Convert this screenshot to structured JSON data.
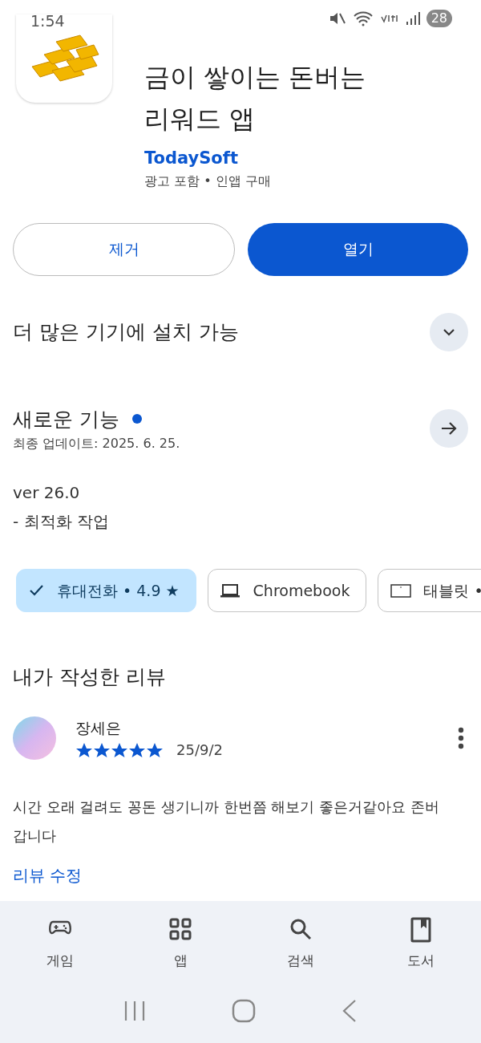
{
  "status_bar": {
    "time": "1:54",
    "battery": "28"
  },
  "app": {
    "title_lines": [
      "금이 쌓이는 돈버는",
      "리워드 앱"
    ],
    "developer": "TodaySoft",
    "info": "광고 포함 • 인앱 구매"
  },
  "buttons": [
    {
      "label": "제거",
      "kind": "outline"
    },
    {
      "label": "열기",
      "kind": "filled"
    }
  ],
  "install_section": {
    "title": "더 많은 기기에 설치 가능",
    "expanded": false
  },
  "whats_new": {
    "title": "새로운 기능",
    "new": true,
    "updated": "최종 업데이트: 2025. 6. 25.",
    "version": "ver 26.0",
    "notes": "- 최적화 작업"
  },
  "device_chips": [
    {
      "label": "휴대전화 • 4.9 ★",
      "kind": "phone",
      "selected": true
    },
    {
      "label": "Chromebook",
      "kind": "laptop",
      "selected": false
    },
    {
      "label": "태블릿 •",
      "kind": "tablet",
      "selected": false
    }
  ],
  "my_review": {
    "heading": "내가 작성한 리뷰",
    "author": "장세은",
    "stars": 5,
    "date": "25/9/2",
    "text": "시간 오래 걸려도 꽁돈 생기니까 한번쯤 해보기 좋은거같아요 존버갑니다",
    "edit_link": "리뷰 수정"
  },
  "bottom_nav": [
    {
      "label": "게임",
      "kind": "games"
    },
    {
      "label": "앱",
      "kind": "apps"
    },
    {
      "label": "검색",
      "kind": "search"
    },
    {
      "label": "도서",
      "kind": "books"
    }
  ]
}
